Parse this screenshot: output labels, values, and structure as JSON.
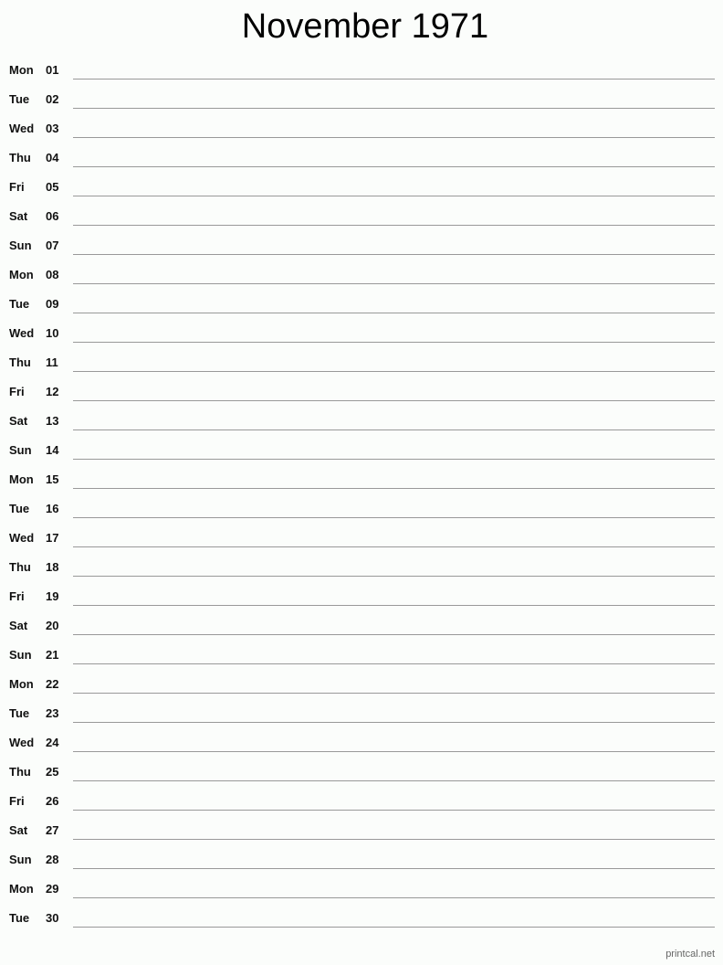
{
  "title": "November 1971",
  "days": [
    {
      "dow": "Mon",
      "day": "01"
    },
    {
      "dow": "Tue",
      "day": "02"
    },
    {
      "dow": "Wed",
      "day": "03"
    },
    {
      "dow": "Thu",
      "day": "04"
    },
    {
      "dow": "Fri",
      "day": "05"
    },
    {
      "dow": "Sat",
      "day": "06"
    },
    {
      "dow": "Sun",
      "day": "07"
    },
    {
      "dow": "Mon",
      "day": "08"
    },
    {
      "dow": "Tue",
      "day": "09"
    },
    {
      "dow": "Wed",
      "day": "10"
    },
    {
      "dow": "Thu",
      "day": "11"
    },
    {
      "dow": "Fri",
      "day": "12"
    },
    {
      "dow": "Sat",
      "day": "13"
    },
    {
      "dow": "Sun",
      "day": "14"
    },
    {
      "dow": "Mon",
      "day": "15"
    },
    {
      "dow": "Tue",
      "day": "16"
    },
    {
      "dow": "Wed",
      "day": "17"
    },
    {
      "dow": "Thu",
      "day": "18"
    },
    {
      "dow": "Fri",
      "day": "19"
    },
    {
      "dow": "Sat",
      "day": "20"
    },
    {
      "dow": "Sun",
      "day": "21"
    },
    {
      "dow": "Mon",
      "day": "22"
    },
    {
      "dow": "Tue",
      "day": "23"
    },
    {
      "dow": "Wed",
      "day": "24"
    },
    {
      "dow": "Thu",
      "day": "25"
    },
    {
      "dow": "Fri",
      "day": "26"
    },
    {
      "dow": "Sat",
      "day": "27"
    },
    {
      "dow": "Sun",
      "day": "28"
    },
    {
      "dow": "Mon",
      "day": "29"
    },
    {
      "dow": "Tue",
      "day": "30"
    }
  ],
  "footer": "printcal.net"
}
